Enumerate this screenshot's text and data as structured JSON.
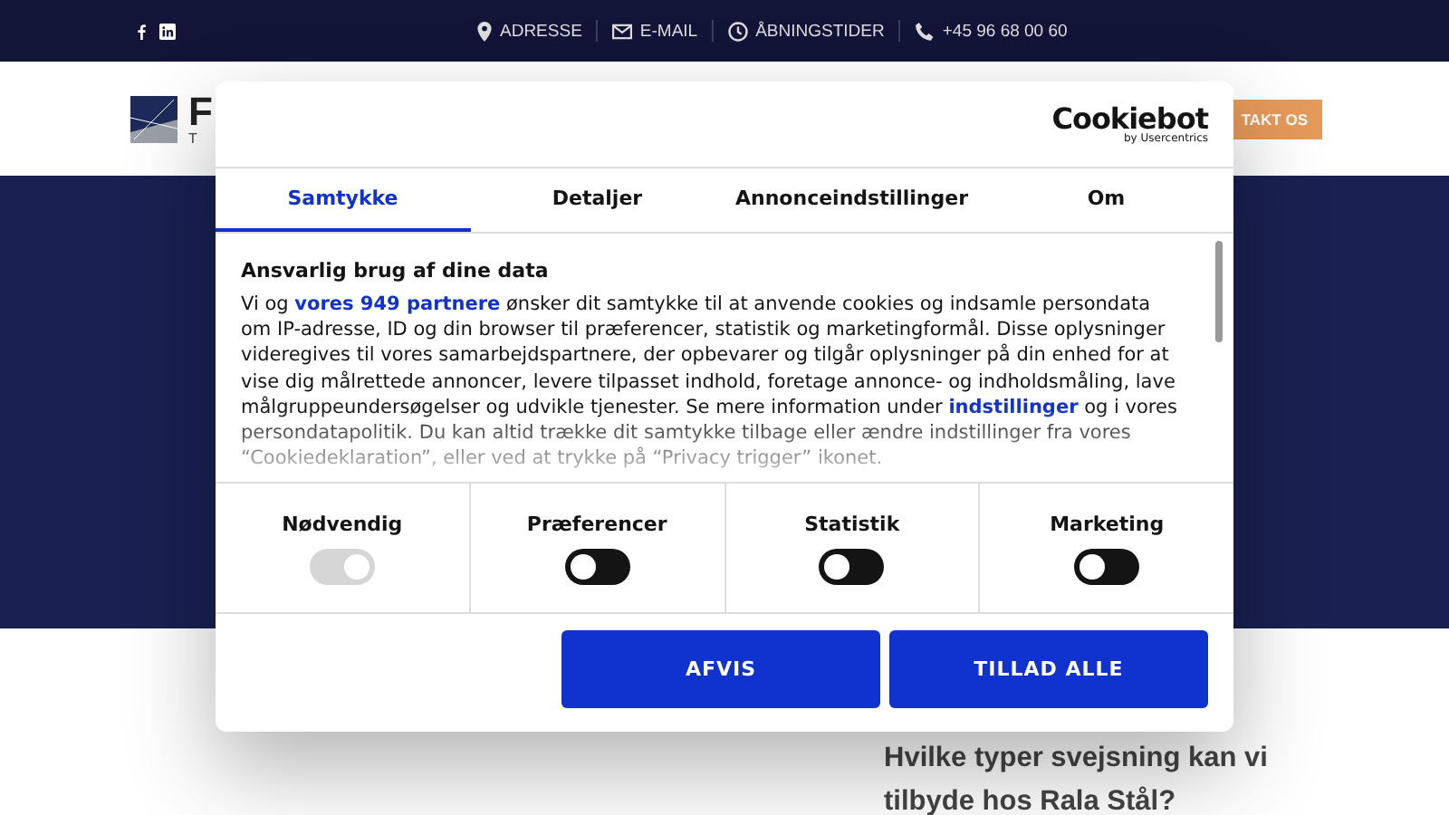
{
  "top_bar": {
    "social": [
      {
        "kind": "facebook"
      },
      {
        "kind": "linkedin"
      }
    ],
    "contacts": [
      {
        "kind": "pin",
        "label": "ADRESSE"
      },
      {
        "kind": "mail",
        "label": "E-MAIL"
      },
      {
        "kind": "clock",
        "label": "ÅBNINGSTIDER"
      },
      {
        "kind": "phone",
        "label": "+45 96 68 00 60"
      }
    ]
  },
  "header": {
    "logo_text": "F",
    "logo_subtext": "T",
    "cta": "TAKT OS"
  },
  "section": {
    "heading": "Hvilke typer svejsning kan vi tilbyde hos Rala Stål?"
  },
  "cookie_dialog": {
    "brand": "Cookiebot",
    "brand_sub": "by Usercentrics",
    "tabs": [
      {
        "label": "Samtykke",
        "selected": true
      },
      {
        "label": "Detaljer",
        "selected": false
      },
      {
        "label": "Annonceindstillinger",
        "selected": false
      },
      {
        "label": "Om",
        "selected": false
      }
    ],
    "heading": "Ansvarlig brug af dine data",
    "parts": [
      {
        "kind": "text",
        "text": "Vi og "
      },
      {
        "kind": "link",
        "text": "vores 949 partnere"
      },
      {
        "kind": "text",
        "text": " ønsker dit samtykke til at anvende cookies og indsamle persondata om IP-adresse, ID og din browser til præferencer, statistik og marketingformål. Disse oplysninger videregives til vores samarbejdspartnere, der opbevarer og tilgår oplysninger på din enhed for at vise dig målrettede annoncer, levere tilpasset indhold, foretage annonce- og indholdsmåling, lave målgruppeundersøgelser og udvikle tjenester. Se mere information under "
      },
      {
        "kind": "link",
        "text": "indstillinger"
      },
      {
        "kind": "text",
        "text": " og i vores persondatapolitik. Du kan altid trække dit samtykke tilbage eller ændre indstillinger fra vores “Cookiedeklaration”, eller ved at trykke på “Privacy trigger” ikonet."
      }
    ],
    "toggles": [
      {
        "label": "Nødvendig",
        "on": true,
        "disabled": true
      },
      {
        "label": "Præferencer",
        "on": false,
        "disabled": false
      },
      {
        "label": "Statistik",
        "on": false,
        "disabled": false
      },
      {
        "label": "Marketing",
        "on": false,
        "disabled": false
      }
    ],
    "buttons": [
      "AFVIS",
      "TILLAD ALLE"
    ]
  }
}
